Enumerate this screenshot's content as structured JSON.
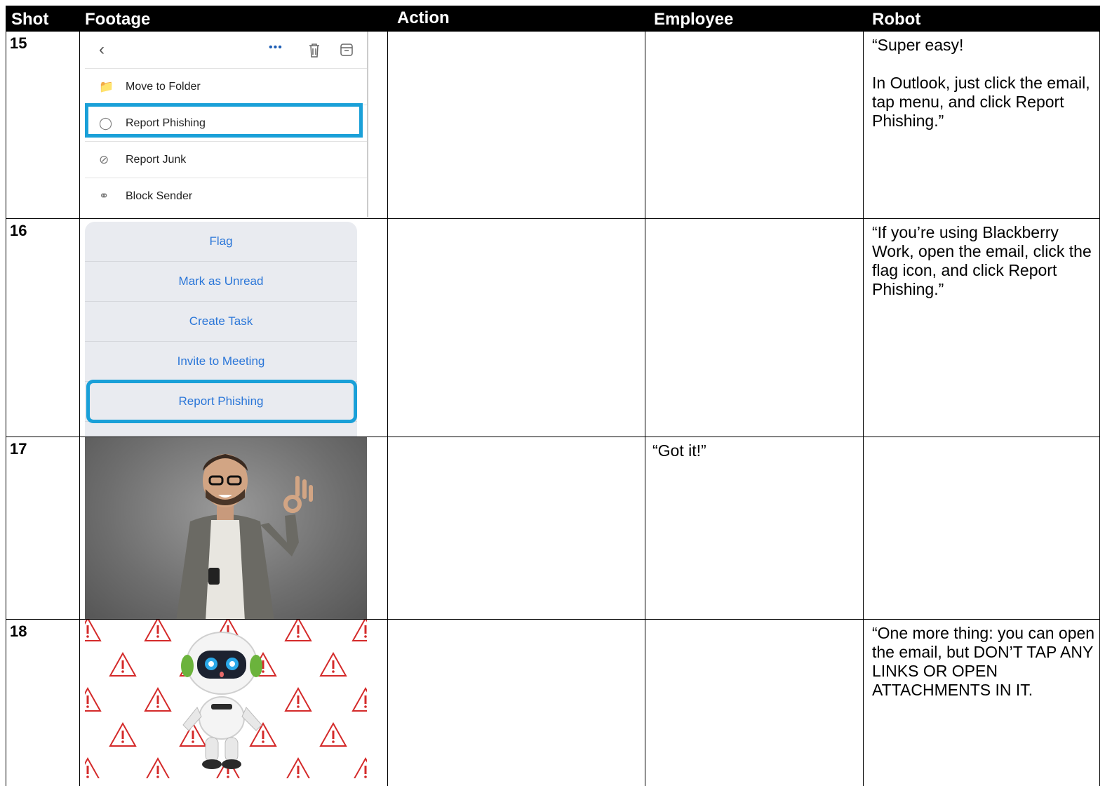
{
  "header": {
    "shot": "Shot",
    "footage": "Footage",
    "action": "Action",
    "employee": "Employee",
    "robot": "Robot"
  },
  "rows": [
    {
      "shot": "15",
      "action": "",
      "employee": "",
      "robot": "“Super easy!\n\nIn Outlook, just click the email, tap menu, and click Report Phishing.”",
      "footage": {
        "items": [
          "Move to Folder",
          "Report Phishing",
          "Report Junk",
          "Block Sender"
        ],
        "highlighted": "Report Phishing"
      }
    },
    {
      "shot": "16",
      "action": "",
      "employee": "",
      "robot": "“If you’re using Blackberry Work, open the email, click the flag icon, and click Report Phishing.”",
      "footage": {
        "items": [
          "Flag",
          "Mark as Unread",
          "Create Task",
          "Invite to Meeting",
          "Report Phishing"
        ],
        "highlighted": "Report Phishing"
      }
    },
    {
      "shot": "17",
      "action": "",
      "employee": "“Got it!”",
      "robot": "",
      "footage": {
        "description": "man-ok-gesture-photo"
      }
    },
    {
      "shot": "18",
      "action": "",
      "employee": "",
      "robot": "“One more thing: you can open the email, but DON’T TAP ANY LINKS OR OPEN ATTACHMENTS IN IT.",
      "footage": {
        "description": "robot-warning-signs"
      }
    }
  ],
  "colors": {
    "highlight": "#1aa0d8",
    "menu_text": "#2a76d8",
    "warning": "#d42a2a"
  }
}
